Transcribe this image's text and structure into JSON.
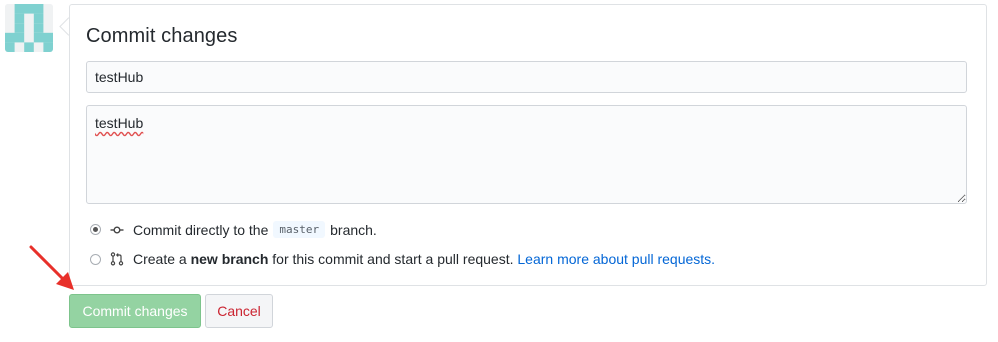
{
  "form": {
    "title": "Commit changes",
    "summary_value": "testHub",
    "description_value": "testHub"
  },
  "options": {
    "direct_prefix": "Commit directly to the",
    "branch_name": "master",
    "direct_suffix": "branch.",
    "new_prefix": "Create a",
    "new_bold": "new branch",
    "new_suffix": "for this commit and start a pull request.",
    "learn_more": "Learn more about pull requests."
  },
  "buttons": {
    "commit_label": "Commit changes",
    "cancel_label": "Cancel"
  },
  "colors": {
    "commit_button_bg": "#94d3a2",
    "cancel_text": "#cb2431",
    "link": "#0366d6",
    "annotation_arrow": "#e8302a",
    "avatar": "#7fd1d0"
  },
  "icons": {
    "avatar": "identicon",
    "option_direct": "git-commit-icon",
    "option_new": "git-pull-request-icon",
    "annotation": "red-arrow-icon"
  }
}
